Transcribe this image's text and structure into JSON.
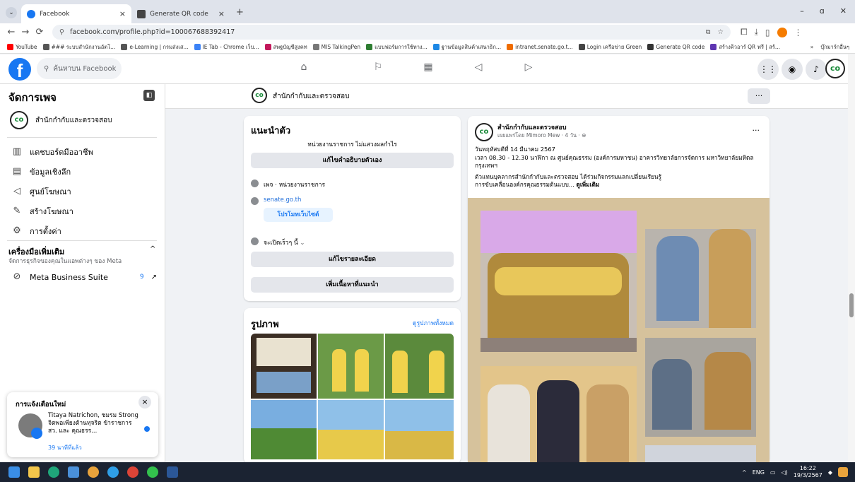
{
  "browser": {
    "tabs": [
      {
        "title": "Facebook",
        "close": "×",
        "active": true
      },
      {
        "title": "Generate QR code",
        "close": "×",
        "active": false
      }
    ],
    "new_tab": "+",
    "url": "facebook.com/profile.php?id=100067688392417",
    "window_controls": {
      "minimize": "–",
      "restore": "ɑ",
      "close": "✕"
    },
    "bookmarks": [
      {
        "label": "YouTube",
        "color": "#ff0000"
      },
      {
        "label": "### ระบบสำนักงานอัตโ...",
        "color": "#555555"
      },
      {
        "label": "e-Learning | กรมส่งเส...",
        "color": "#555555"
      },
      {
        "label": "IE Tab - Chrome เว็บ...",
        "color": "#3b82f6"
      },
      {
        "label": "สพฐบัญชีสูงคท",
        "color": "#c2185b"
      },
      {
        "label": "MIS TalkingPen",
        "color": "#777777"
      },
      {
        "label": "แบบฟอร์มการใช้ทาง...",
        "color": "#2e7d32"
      },
      {
        "label": "ฐานข้อมูลสินค้าเสนาธิก...",
        "color": "#1e88e5"
      },
      {
        "label": "intranet.senate.go.t...",
        "color": "#ef6c00"
      },
      {
        "label": "Login เครือข่าย Green",
        "color": "#444444"
      },
      {
        "label": "Generate QR code",
        "color": "#333333"
      },
      {
        "label": "สร้างคิวอาร์ QR ฟรี | สร้...",
        "color": "#5e35b1"
      }
    ],
    "bookmarks_more": "»",
    "bookmarks_folder": "บุ๊กมาร์กอื่นๆ"
  },
  "fb": {
    "search_placeholder": "ค้นหาบน Facebook",
    "page_name": "สำนักกำกับและตรวจสอบ",
    "page_logo_text": "co",
    "more_dots": "···"
  },
  "sidebar": {
    "title": "จัดการเพจ",
    "items": [
      {
        "label": "แดชบอร์ดมืออาชีพ",
        "icon": "▥"
      },
      {
        "label": "ข้อมูลเชิงลึก",
        "icon": "▤"
      },
      {
        "label": "ศูนย์โฆษณา",
        "icon": "◁"
      },
      {
        "label": "สร้างโฆษณา",
        "icon": "✎"
      },
      {
        "label": "การตั้งค่า",
        "icon": "⚙"
      }
    ],
    "tools_title": "เครื่องมือเพิ่มเติม",
    "tools_subtitle": "จัดการธุรกิจของคุณในแอพต่างๆ ของ Meta",
    "meta_suite": "Meta Business Suite",
    "meta_badge": "9",
    "meta_arrow": "↗",
    "chevron": "^"
  },
  "notification": {
    "title": "การแจ้งเตือนใหม่",
    "text": "Titaya Natrichon, ชมรม Strong จิตพอเพียงต้านทุจริต ข้าราชการ สว. และ คุณธรร...",
    "time": "39 นาทีที่แล้ว",
    "close": "×"
  },
  "intro": {
    "heading": "แนะนำตัว",
    "subtitle": "หน่วยงานราชการ ไม่แสวงผลกำไร",
    "edit_bio": "แก้ไขคำอธิบายตัวเอง",
    "page_type": "เพจ · หน่วยงานราชการ",
    "website": "senate.go.th",
    "promote": "โปรโมทเว็บไซต์",
    "hours": "จะเปิดเร็วๆ นี้",
    "hours_chevron": "⌄",
    "edit_details": "แก้ไขรายละเอียด",
    "add_featured": "เพิ่มเนื้อหาที่แนะนำ"
  },
  "photos": {
    "heading": "รูปภาพ",
    "see_all": "ดูรูปภาพทั้งหมด"
  },
  "post": {
    "author": "สำนักกำกับและตรวจสอบ",
    "meta": "เผยแพร่โดย Mimoro Mew · 4 วัน ·",
    "line1": "วันพฤหัสบดีที่ 14 มีนาคม 2567",
    "line2": "เวลา 08.30 - 12.30 นาฬิกา ณ ศูนย์คุณธรรม (องค์การมหาชน) อาคารวิทยาลัยการจัดการ มหาวิทยาลัยมหิดล กรุงเทพฯ",
    "line3": "ตัวแทนบุคลากรสำนักกำกับและตรวจสอบ ได้ร่วมกิจกรรมแลกเปลี่ยนเรียนรู้",
    "line4": "การขับเคลื่อนองค์กรคุณธรรมต้นแบบ...",
    "see_more": "ดูเพิ่มเติม"
  },
  "taskbar": {
    "lang": "ENG",
    "time": "16:22",
    "date": "19/3/2567"
  },
  "colors": {
    "fb_blue": "#1877f2",
    "chrome_tabstrip": "#dfe3eb",
    "taskbar": "#1b2332"
  }
}
